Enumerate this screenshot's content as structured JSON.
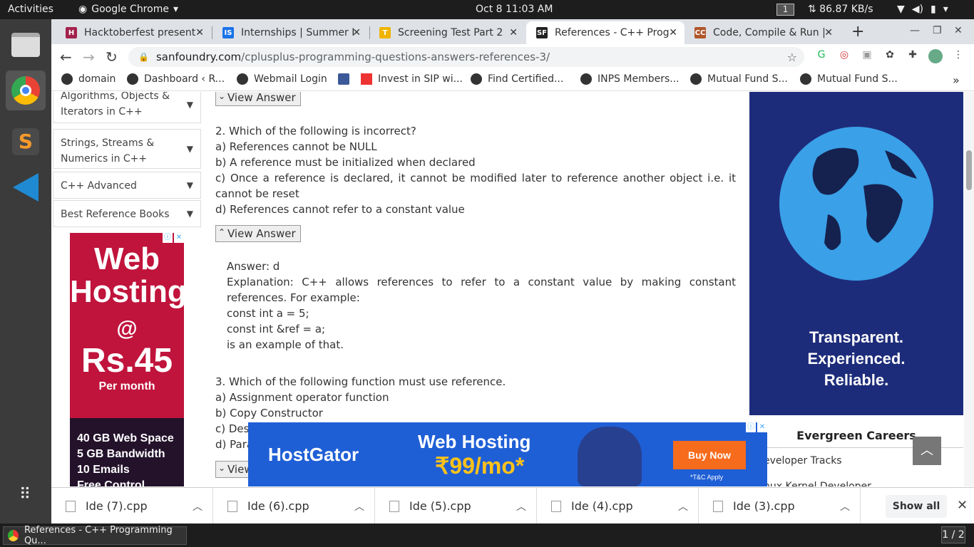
{
  "system": {
    "activities": "Activities",
    "app_menu": "Google Chrome",
    "clock": "Oct 8  11:03 AM",
    "workspace": "1",
    "net_speed": "⇅ 86.87 KB/s"
  },
  "tabs": [
    {
      "label": "Hacktoberfest present",
      "icon_text": "H",
      "icon_color": "#a3224c"
    },
    {
      "label": "Internships | Summer I",
      "icon_text": "IS",
      "icon_color": "#1a73e8"
    },
    {
      "label": "Screening Test Part 2",
      "icon_text": "T",
      "icon_color": "#f0b400"
    },
    {
      "label": "References - C++ Progra",
      "icon_text": "SF",
      "icon_color": "#222222"
    },
    {
      "label": "Code, Compile & Run | C",
      "icon_text": "CC",
      "icon_color": "#b0562a"
    }
  ],
  "address": {
    "domain": "sanfoundry.com",
    "path": "/cplusplus-programming-questions-answers-references-3/"
  },
  "bookmarks": [
    "domain",
    "Dashboard ‹ R...",
    "Webmail Login",
    "Invest in SIP wi...",
    "Find Certified...",
    "INPS Members...",
    "Mutual Fund S...",
    "Mutual Fund S..."
  ],
  "sidebar": {
    "items": [
      {
        "label": "Algorithms, Objects & Iterators in C++"
      },
      {
        "label": "Strings, Streams & Numerics in C++"
      },
      {
        "label": "C++ Advanced"
      },
      {
        "label": "Best Reference Books"
      }
    ],
    "ad": {
      "line1": "Web",
      "line2": "Hosting",
      "line3": "@",
      "price": "Rs.45",
      "per": "Per month",
      "feat1": "40 GB Web Space",
      "feat2": "5 GB Bandwidth",
      "feat3": "10 Emails",
      "feat4": "Free Control Panel"
    }
  },
  "content": {
    "view_answer": "View Answer",
    "q2": "2. Which of the following is incorrect?",
    "q2a": "a) References cannot be NULL",
    "q2b": "b) A reference must be initialized when declared",
    "q2c": "c) Once a reference is declared, it cannot be modified later to reference another object i.e. it cannot be reset",
    "q2d": "d) References cannot refer to a constant value",
    "answer": "Answer: d",
    "explanation": "Explanation: C++ allows references to refer to a constant value by making constant references. For example:",
    "code1": "const int a = 5;",
    "code2": "const int &ref = a;",
    "exp_end": "is an example of that.",
    "q3": "3. Which of the following function must use reference.",
    "q3a": "a) Assignment operator function",
    "q3b": "b) Copy Constructor",
    "q3c": "c) Dest",
    "q3d": "d) Para",
    "va_partial": "View"
  },
  "right_ad": {
    "line1": "Transparent.",
    "line2": "Experienced.",
    "line3": "Reliable."
  },
  "evergreen": {
    "title": "Evergreen Careers",
    "item1": "eveloper Tracks",
    "item2": "nux Kernel Developer"
  },
  "bottom_ad": {
    "brand": "HostGator",
    "headline": "Web Hosting",
    "price": "₹99/mo*",
    "cta": "Buy Now",
    "tc": "*T&C Apply"
  },
  "downloads": [
    "Ide (7).cpp",
    "Ide (6).cpp",
    "Ide (5).cpp",
    "Ide (4).cpp",
    "Ide (3).cpp"
  ],
  "show_all": "Show all",
  "taskbar": {
    "window": "References - C++ Programming Qu...",
    "pager": "1 / 2"
  }
}
